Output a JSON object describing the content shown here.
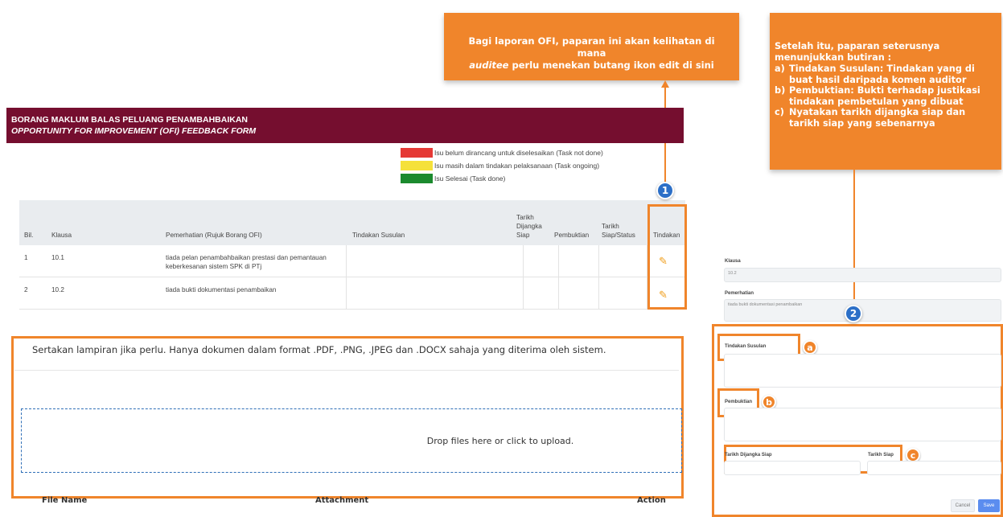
{
  "callouts": {
    "c1_line1": "Bagi laporan OFI, paparan ini akan kelihatan di mana",
    "c1_em": "auditee",
    "c1_rest": " perlu menekan butang ikon edit di sini",
    "c2_intro": "Setelah itu, paparan seterusnya menunjukkan butiran :",
    "c2_items": [
      {
        "mark": "a)",
        "text": "Tindakan Susulan: Tindakan yang di buat hasil daripada komen auditor"
      },
      {
        "mark": "b)",
        "text": "Pembuktian: Bukti terhadap justikasi tindakan pembetulan yang dibuat"
      },
      {
        "mark": "c)",
        "text": "Nyatakan tarikh dijangka siap dan tarikh siap yang sebenarnya"
      }
    ]
  },
  "form": {
    "title_ms": "BORANG MAKLUM BALAS PELUANG PENAMBAHBAIKAN",
    "title_en": "OPPORTUNITY FOR IMPROVEMENT (OFI) FEEDBACK FORM"
  },
  "legend": [
    {
      "color": "#e53935",
      "text": "Isu belum dirancang untuk diselesaikan (Task not done)"
    },
    {
      "color": "#f5e13a",
      "text": "Isu masih dalam tindakan pelaksanaan (Task ongoing)"
    },
    {
      "color": "#1b8a2e",
      "text": "Isu Selesai (Task done)"
    }
  ],
  "table": {
    "headers": {
      "bil": "Bil.",
      "klausa": "Klausa",
      "pemerhatian": "Pemerhatian (Rujuk Borang OFI)",
      "tindakan_susulan": "Tindakan Susulan",
      "tarikh_dijangka_1": "Tarikh",
      "tarikh_dijangka_2": "Dijangka",
      "tarikh_dijangka_3": "Siap",
      "pembuktian": "Pembuktian",
      "tarikh_siap_1": "Tarikh",
      "tarikh_siap_2": "Siap/Status",
      "tindakan": "Tindakan"
    },
    "rows": [
      {
        "bil": "1",
        "klausa": "10.1",
        "pemerhatian_1": "tiada pelan penambahbaikan prestasi dan pemantauan",
        "pemerhatian_2": "keberkesanan sistem SPK di PTj",
        "action_icon": "pencil-icon"
      },
      {
        "bil": "2",
        "klausa": "10.2",
        "pemerhatian_1": "tiada bukti dokumentasi penambaikan",
        "pemerhatian_2": "",
        "action_icon": "pencil-icon"
      }
    ]
  },
  "badges": {
    "one": "1",
    "two": "2",
    "a": "a",
    "b": "b",
    "c": "c"
  },
  "upload": {
    "note": "Sertakan lampiran jika perlu. Hanya dokumen dalam format .PDF, .PNG, .JPEG dan .DOCX sahaja yang diterima oleh sistem.",
    "dropzone": "Drop files here or click to upload.",
    "col_file_name": "File Name",
    "col_attachment": "Attachment",
    "col_action": "Action"
  },
  "edit_form": {
    "klausa_label": "Klausa",
    "klausa_value": "10.2",
    "pemerhatian_label": "Pemerhatian",
    "pemerhatian_value": "tiada bukti dokumentasi penambaikan",
    "tindakan_susulan_label": "Tindakan Susulan",
    "pembuktian_label": "Pembuktian",
    "tarikh_dijangka_label": "Tarikh Dijangka Siap",
    "tarikh_siap_label": "Tarikh Siap",
    "cancel_label": "Cancel",
    "save_label": "Save"
  },
  "colors": {
    "accent_orange": "#f0852b",
    "header_maroon": "#750e2f",
    "badge_blue": "#2c6fc7",
    "save_blue": "#5b8def"
  }
}
